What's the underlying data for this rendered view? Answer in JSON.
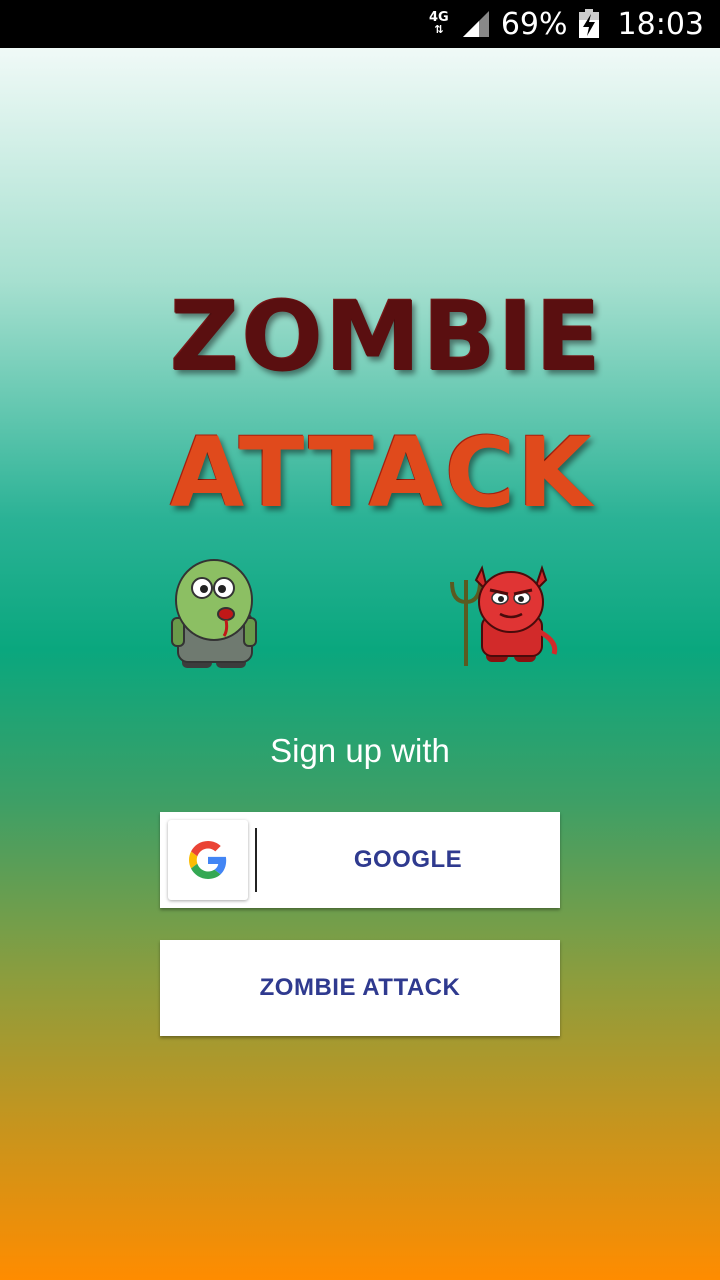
{
  "status_bar": {
    "network": "4G",
    "battery_percent": "69%",
    "time": "18:03"
  },
  "logo": {
    "line1": "ZOMBIE",
    "line2": "ATTACK"
  },
  "signup": {
    "label": "Sign up with",
    "google_button": "GOOGLE",
    "zombie_button": "ZOMBIE ATTACK"
  },
  "colors": {
    "button_text": "#2f3a8f",
    "logo_dark_red": "#5a0f10",
    "logo_orange_red": "#e04a1c",
    "gradient_top": "#ffffff",
    "gradient_mid": "#0aa77e",
    "gradient_bottom": "#ff8c00"
  },
  "icons": {
    "google": "google-g-icon",
    "zombie": "zombie-character-icon",
    "devil": "devil-character-icon"
  }
}
